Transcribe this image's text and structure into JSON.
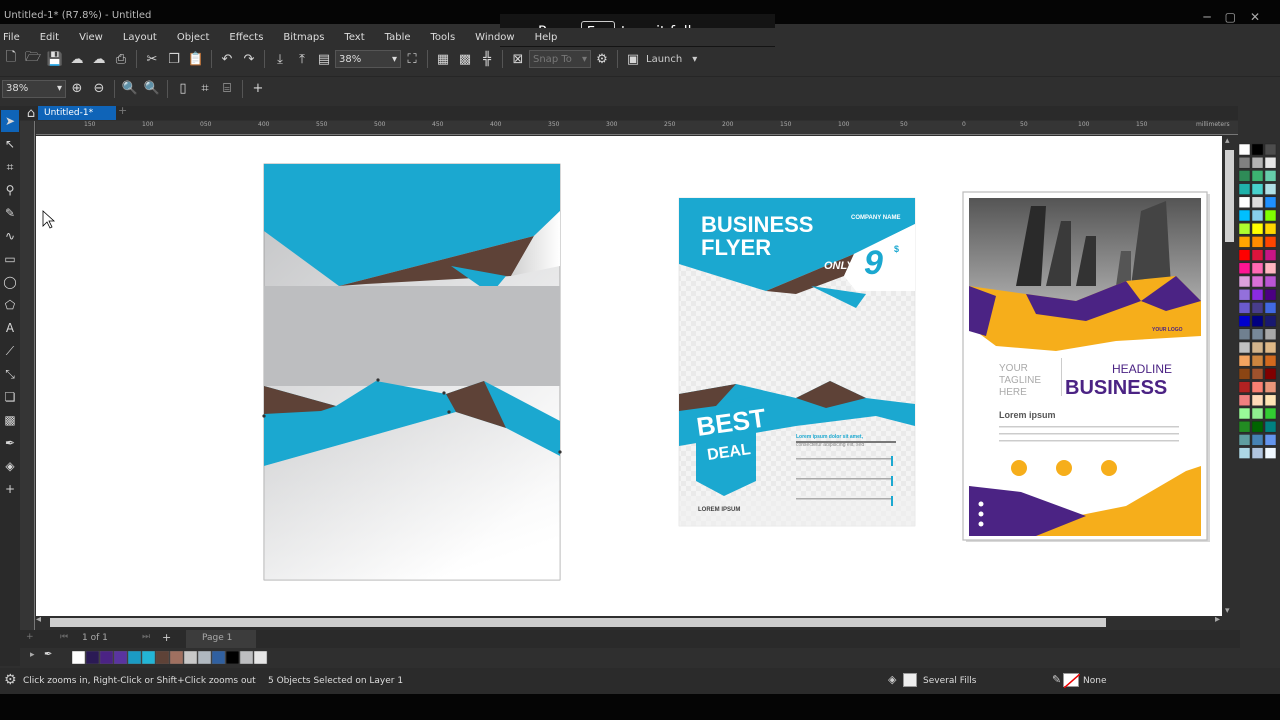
{
  "window": {
    "title": "Untitled-1* (R7.8%) - Untitled"
  },
  "fullscreen_notice": {
    "press": "Press",
    "key": "Esc",
    "rest": "to exit full screen"
  },
  "menu": [
    "File",
    "Edit",
    "View",
    "Layout",
    "Object",
    "Effects",
    "Bitmaps",
    "Text",
    "Table",
    "Tools",
    "Window",
    "Help"
  ],
  "toolbar": {
    "zoom_value": "38%",
    "snap_label": "Snap To",
    "launch_label": "Launch"
  },
  "toolbar2": {
    "zoom_value": "38%"
  },
  "document_tab": {
    "label": "Untitled-1*"
  },
  "ruler": {
    "unit": "millimeters",
    "ticks": [
      "150",
      "100",
      "050",
      "400",
      "550",
      "500",
      "450",
      "400",
      "350",
      "300",
      "250",
      "200",
      "150",
      "100",
      "50",
      "0",
      "50",
      "100",
      "150"
    ]
  },
  "flyer1": {
    "title_line1": "BUSINESS",
    "title_line2": "FLYER",
    "company": "COMPANY NAME",
    "only": "ONLY",
    "price": "9",
    "currency": "$",
    "best": "BEST",
    "deal": "DEAL",
    "lorem": "LOREM IPSUM",
    "text_line1": "Lorem ipsum dolor sit amet,",
    "text_line2": "consectetur adipiscing elit, sed"
  },
  "flyer2": {
    "logo": "YOUR LOGO",
    "tagline_l1": "YOUR",
    "tagline_l2": "TAGLINE",
    "tagline_l3": "HERE",
    "headline": "HEADLINE",
    "business": "BUSINESS",
    "lorem": "Lorem ipsum"
  },
  "page_nav": {
    "count": "1 of 1",
    "page_tab": "Page 1"
  },
  "status": {
    "hint": "Click zooms in, Right-Click or Shift+Click zooms out",
    "selection": "5 Objects Selected on Layer 1",
    "fill": "Several Fills",
    "outline": "None"
  },
  "colors": {
    "accent": "#0f64b8",
    "cyan": "#1ba8d0",
    "brown": "#5e4237",
    "gray": "#bdbec0",
    "purple": "#4b2384",
    "orange": "#f6ae1b"
  },
  "palette_colors": [
    "#ffffff",
    "#000000",
    "#4d4d4d",
    "#808080",
    "#b3b3b3",
    "#e6e6e6",
    "#2e8b57",
    "#3cb371",
    "#66cdaa",
    "#20b2aa",
    "#48d1cc",
    "#b0e0e6",
    "#ffffff",
    "#dddddd",
    "#1e90ff",
    "#00bfff",
    "#87ceeb",
    "#7fff00",
    "#adff2f",
    "#ffff00",
    "#ffd700",
    "#ffa500",
    "#ff8c00",
    "#ff4500",
    "#ff0000",
    "#dc143c",
    "#c71585",
    "#ff1493",
    "#ff69b4",
    "#ffb6c1",
    "#dda0dd",
    "#da70d6",
    "#ba55d3",
    "#9370db",
    "#8a2be2",
    "#4b0082",
    "#6a5acd",
    "#483d8b",
    "#4169e1",
    "#0000cd",
    "#000080",
    "#191970",
    "#708090",
    "#778899",
    "#a9a9a9",
    "#c0c0c0",
    "#d2b48c",
    "#deb887",
    "#f4a460",
    "#cd853f",
    "#d2691e",
    "#8b4513",
    "#a0522d",
    "#800000",
    "#b22222",
    "#fa8072",
    "#e9967a",
    "#f08080",
    "#ffdab9",
    "#ffe4b5",
    "#98fb98",
    "#90ee90",
    "#32cd32",
    "#228b22",
    "#006400",
    "#008080",
    "#5f9ea0",
    "#4682b4",
    "#6495ed",
    "#add8e6",
    "#b0c4de",
    "#f0f8ff"
  ],
  "doc_palette_colors": [
    "#ffffff",
    "#2b1a55",
    "#4b2384",
    "#5a34a0",
    "#1b9bc4",
    "#23b5d6",
    "#5e4237",
    "#a07060",
    "#c8c8c8",
    "#b0b8c0",
    "#3060a0",
    "#000000",
    "#bdbec0",
    "#e6e6e6"
  ]
}
